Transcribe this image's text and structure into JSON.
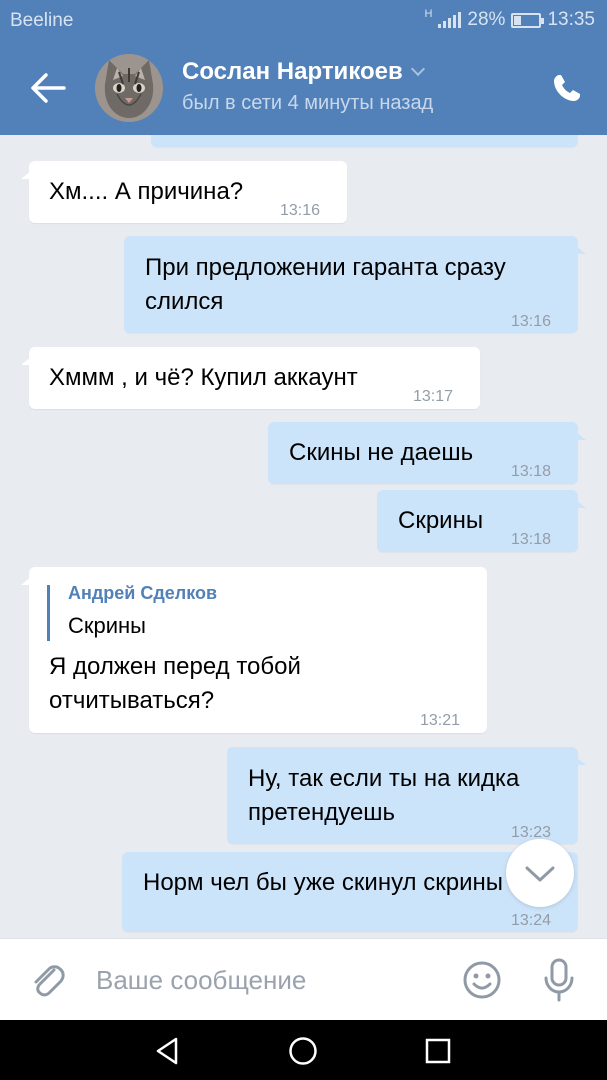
{
  "status_bar": {
    "carrier": "Beeline",
    "network": "H",
    "battery": "28%",
    "battery_level": 0.28,
    "time": "13:35"
  },
  "header": {
    "contact_name": "Сослан Нартикоев",
    "last_seen": "был в сети 4 минуты назад",
    "icons": [
      "back-arrow-icon",
      "chevron-down-icon",
      "phone-icon"
    ]
  },
  "messages": [
    {
      "direction": "in",
      "text": "Хм.... А причина?",
      "time": "13:16"
    },
    {
      "direction": "out",
      "lines": [
        "При предложении гаранта сразу",
        "слился"
      ],
      "time": "13:16"
    },
    {
      "direction": "in",
      "text": "Хммм , и чё? Купил аккаунт",
      "time": "13:17"
    },
    {
      "direction": "out",
      "text": "Скины не даешь",
      "time": "13:18"
    },
    {
      "direction": "out",
      "text": "Скрины",
      "time": "13:18"
    },
    {
      "direction": "in",
      "reply": {
        "author": "Андрей Сделков",
        "text": "Скрины"
      },
      "lines": [
        "Я должен перед тобой",
        "отчитываться?"
      ],
      "time": "13:21"
    },
    {
      "direction": "out",
      "lines": [
        "Ну, так если ты на кидка",
        "претендуешь"
      ],
      "time": "13:23"
    },
    {
      "direction": "out",
      "text": "Норм чел бы уже скинул скрины",
      "time": "13:24"
    }
  ],
  "composer": {
    "placeholder": "Ваше сообщение",
    "icons": [
      "paperclip-icon",
      "emoji-icon",
      "microphone-icon"
    ]
  },
  "nav_bar": {
    "icons": [
      "back-triangle-icon",
      "home-circle-icon",
      "recents-square-icon"
    ]
  },
  "colors": {
    "header": "#5181b8",
    "incoming_bubble": "#ffffff",
    "outgoing_bubble": "#cce4fa",
    "chat_background": "#e8ecf1",
    "timestamp": "#939da8"
  }
}
